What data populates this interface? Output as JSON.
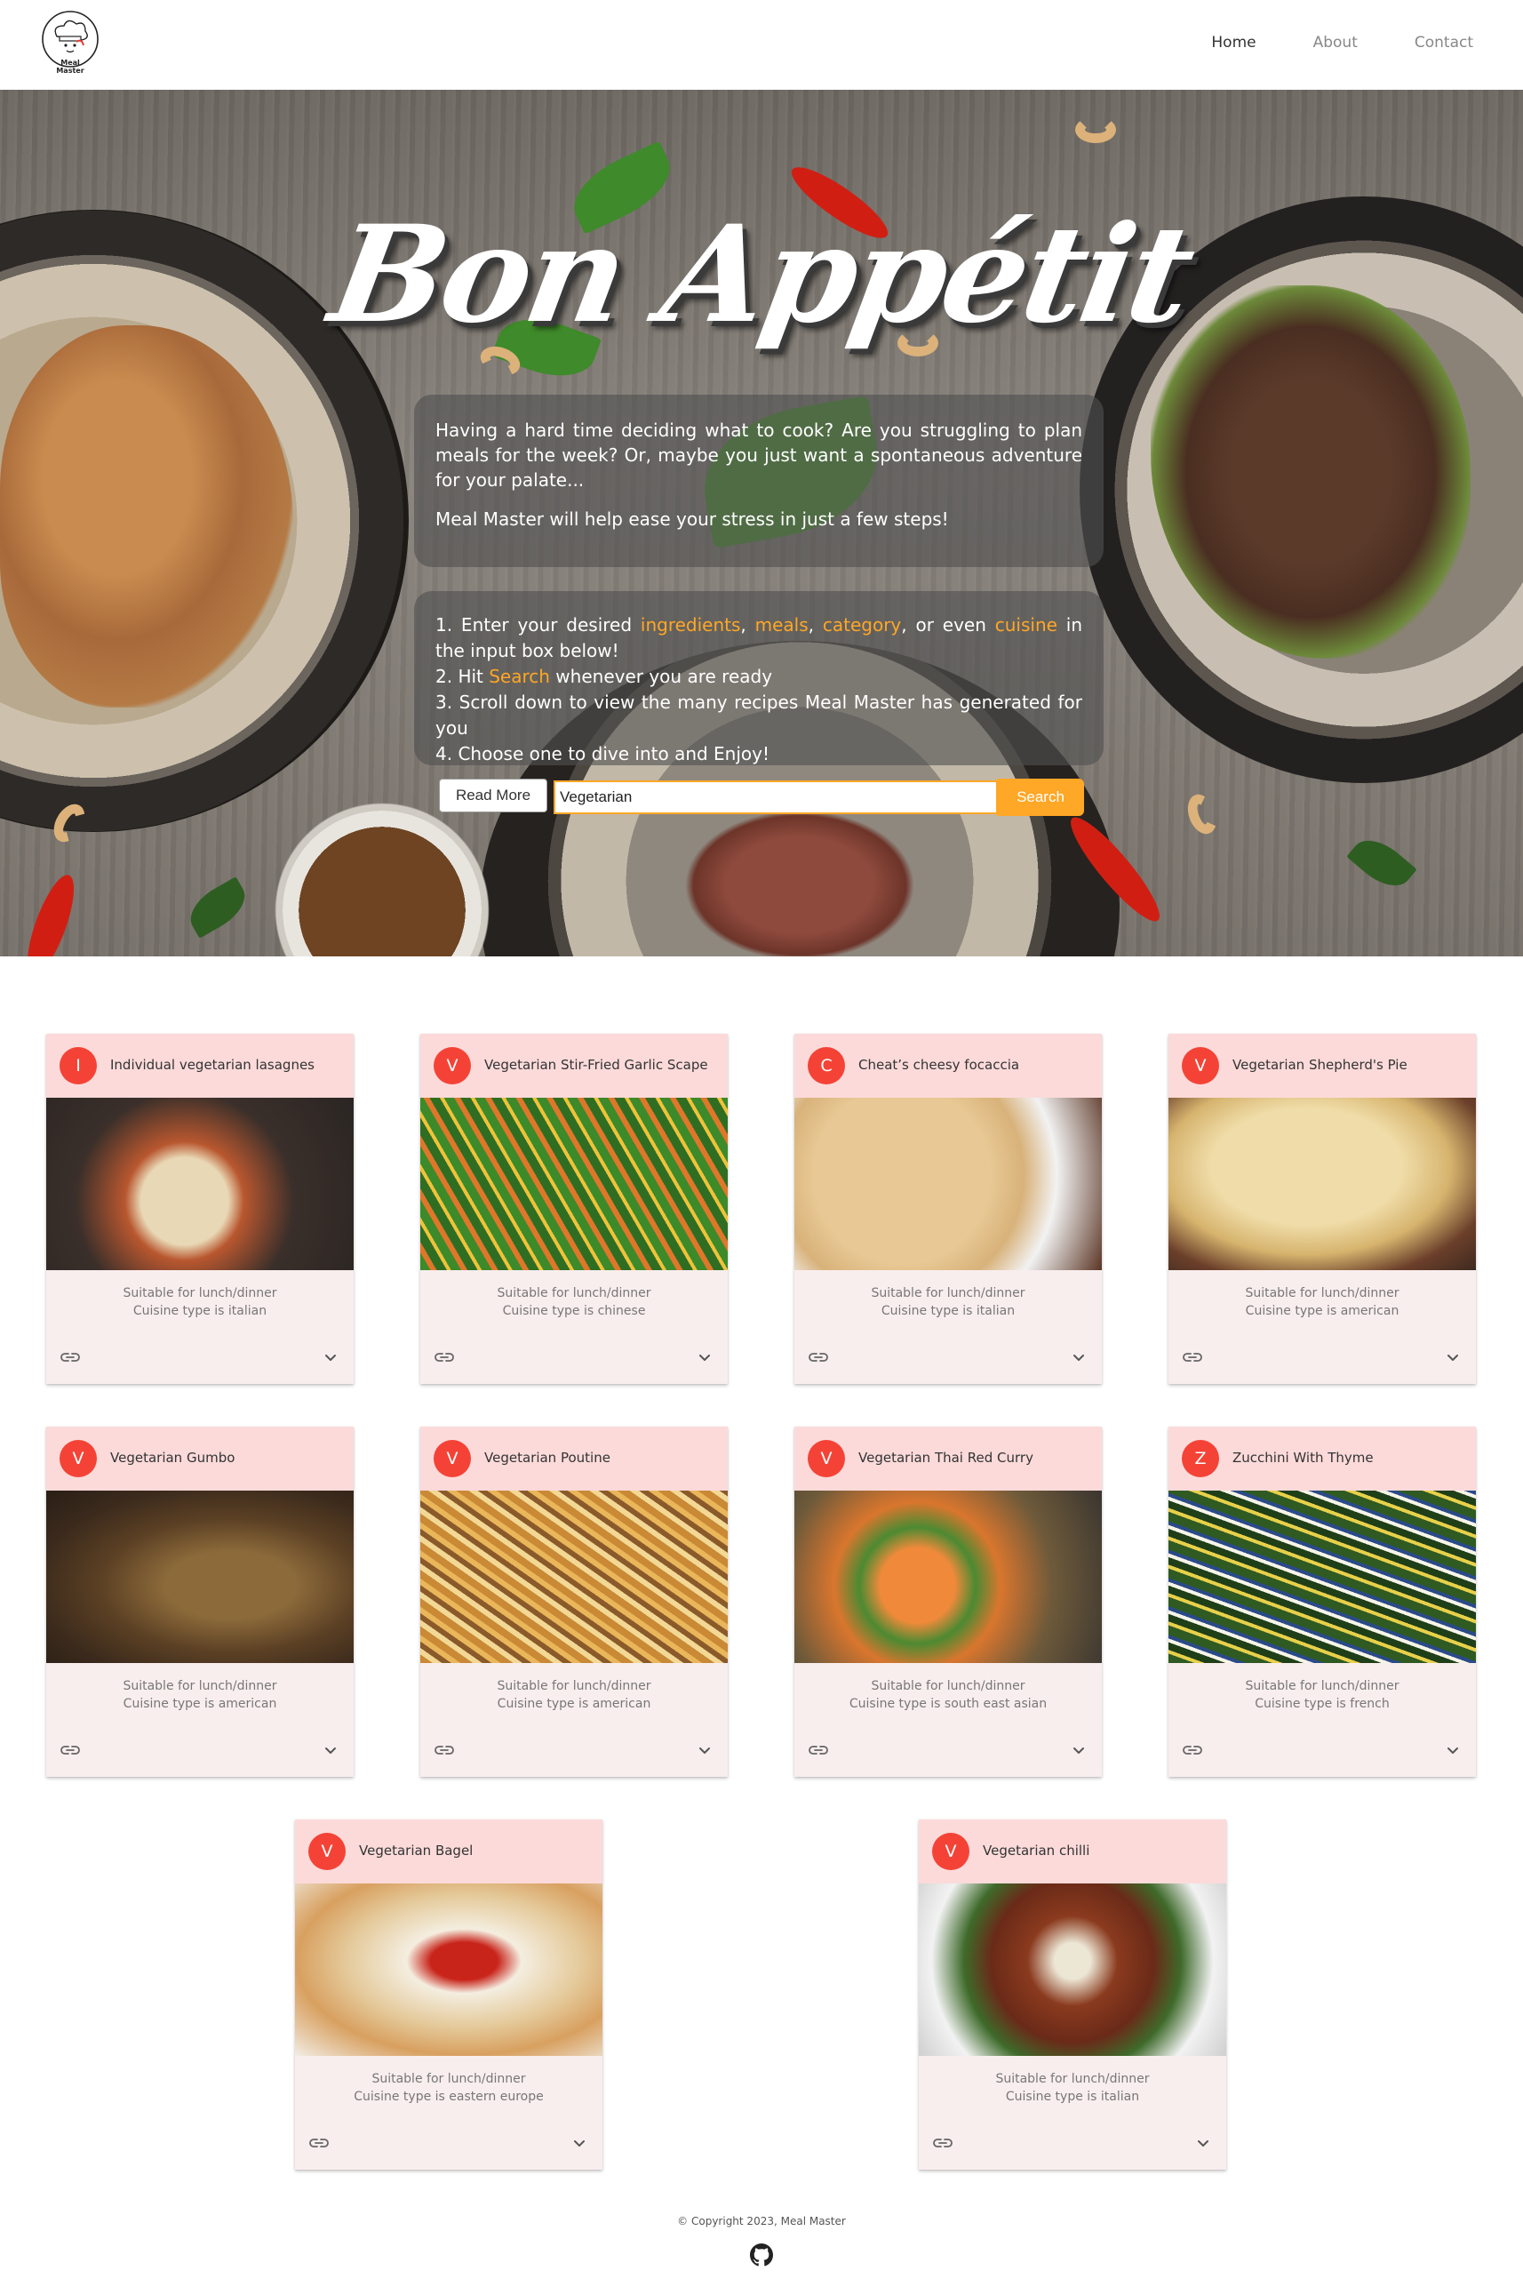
{
  "brand": {
    "logo_text_1": "Meal",
    "logo_text_2": "Master"
  },
  "nav": [
    {
      "label": "Home",
      "active": true
    },
    {
      "label": "About",
      "active": false
    },
    {
      "label": "Contact",
      "active": false
    }
  ],
  "hero": {
    "title": "Bon Appétit",
    "intro_1": "Having a hard time deciding what to cook? Are you struggling to plan meals for the week? Or, maybe you just want a spontaneous adventure for your palate...",
    "intro_2": "Meal Master will help ease your stress in just a few steps!",
    "step1_a": "1. Enter your desired ",
    "step1_ingredients": "ingredients",
    "step1_sep1": ", ",
    "step1_meals": "meals",
    "step1_sep2": ", ",
    "step1_category": "category",
    "step1_b": ", or even ",
    "step1_cuisine": "cuisine",
    "step1_c": " in the input box below!",
    "step2_a": "2. Hit ",
    "step2_search": "Search",
    "step2_b": " whenever you are ready",
    "step3": "3. Scroll down to view the many recipes Meal Master has generated for you",
    "step4": "4. Choose one to dive into and Enjoy!",
    "highlight_color": "#ffa726"
  },
  "search": {
    "read_more_label": "Read More",
    "value": "Vegetarian",
    "button_label": "Search"
  },
  "cards": [
    {
      "letter": "I",
      "title": "Individual vegetarian lasagnes",
      "line1": "Suitable for lunch/dinner",
      "line2": "Cuisine type is italian"
    },
    {
      "letter": "V",
      "title": "Vegetarian Stir-Fried Garlic Scape",
      "line1": "Suitable for lunch/dinner",
      "line2": "Cuisine type is chinese"
    },
    {
      "letter": "C",
      "title": "Cheat’s cheesy focaccia",
      "line1": "Suitable for lunch/dinner",
      "line2": "Cuisine type is italian"
    },
    {
      "letter": "V",
      "title": "Vegetarian Shepherd's Pie",
      "line1": "Suitable for lunch/dinner",
      "line2": "Cuisine type is american"
    },
    {
      "letter": "V",
      "title": "Vegetarian Gumbo",
      "line1": "Suitable for lunch/dinner",
      "line2": "Cuisine type is american"
    },
    {
      "letter": "V",
      "title": "Vegetarian Poutine",
      "line1": "Suitable for lunch/dinner",
      "line2": "Cuisine type is american"
    },
    {
      "letter": "V",
      "title": "Vegetarian Thai Red Curry",
      "line1": "Suitable for lunch/dinner",
      "line2": "Cuisine type is south east asian"
    },
    {
      "letter": "Z",
      "title": "Zucchini With Thyme",
      "line1": "Suitable for lunch/dinner",
      "line2": "Cuisine type is french"
    },
    {
      "letter": "V",
      "title": "Vegetarian Bagel",
      "line1": "Suitable for lunch/dinner",
      "line2": "Cuisine type is eastern europe"
    },
    {
      "letter": "V",
      "title": "Vegetarian chilli",
      "line1": "Suitable for lunch/dinner",
      "line2": "Cuisine type is italian"
    }
  ],
  "footer": {
    "copyright": "© Copyright 2023, Meal Master"
  },
  "icons": {
    "card_link": "link-icon",
    "card_expand": "chevron-down-icon",
    "footer": "github-icon"
  },
  "colors": {
    "accent": "#ffa726",
    "avatar": "#f44336",
    "card_header": "#fcdada",
    "card_body": "#f9eeee"
  }
}
